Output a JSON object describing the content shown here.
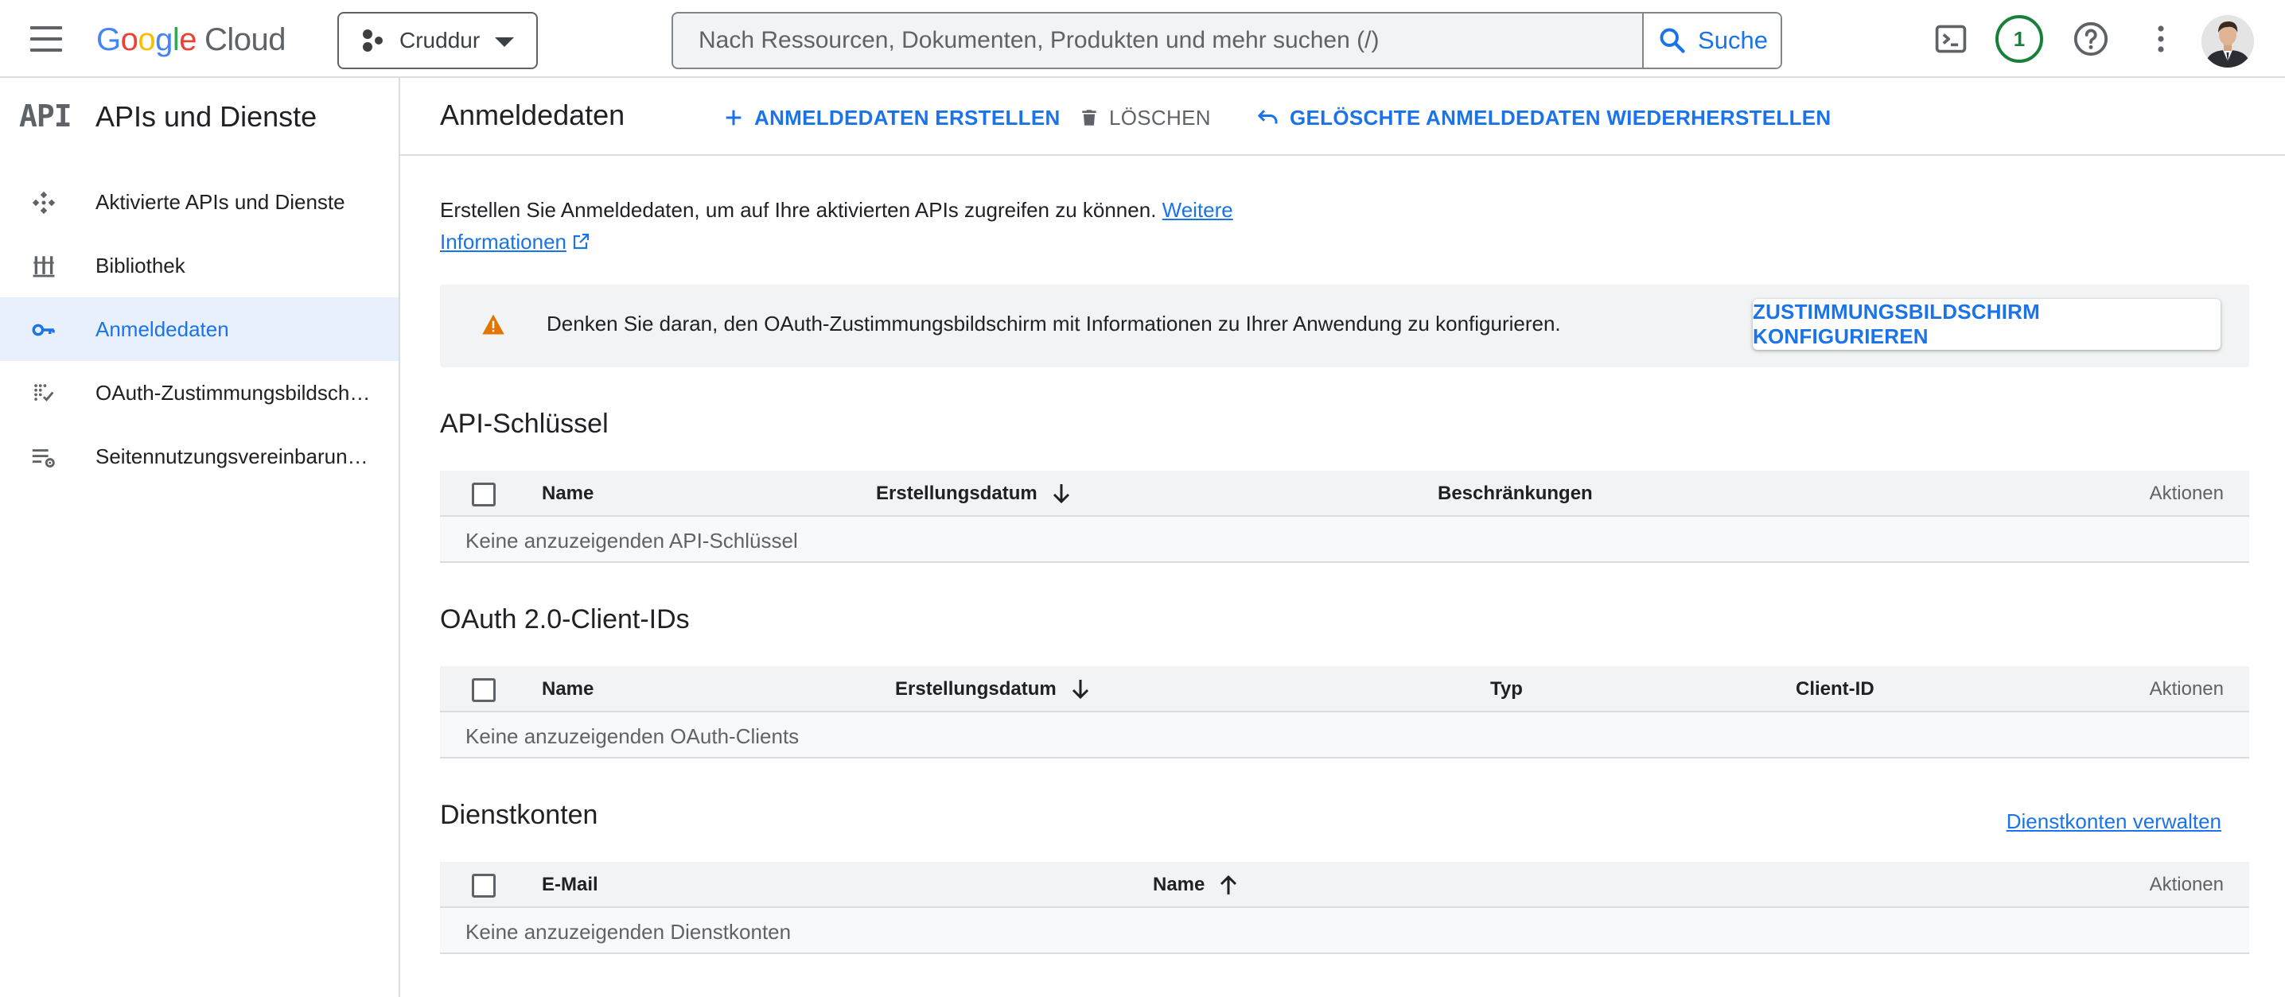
{
  "header": {
    "logo_letters": [
      "G",
      "o",
      "o",
      "g",
      "l",
      "e"
    ],
    "logo_product": "Cloud",
    "project_name": "Cruddur",
    "search_placeholder": "Nach Ressourcen, Dokumenten, Produkten und mehr suchen (/)",
    "search_button": "Suche",
    "notification_count": "1",
    "icons": [
      "menu-icon",
      "project-icon",
      "search-icon",
      "cloud-shell-icon",
      "help-icon",
      "more-vert-icon"
    ]
  },
  "sidebar": {
    "logo": "API",
    "title": "APIs und Dienste",
    "items": [
      {
        "label": "Aktivierte APIs und Dienste",
        "icon": "enabled-apis-icon",
        "active": false
      },
      {
        "label": "Bibliothek",
        "icon": "library-icon",
        "active": false
      },
      {
        "label": "Anmeldedaten",
        "icon": "key-icon",
        "active": true
      },
      {
        "label": "OAuth-Zustimmungsbildschirm",
        "icon": "consent-screen-icon",
        "active": false
      },
      {
        "label": "Seitennutzungsvereinbarungen",
        "icon": "page-usage-icon",
        "active": false
      }
    ]
  },
  "toolbar": {
    "title": "Anmeldedaten",
    "create_label": "ANMELDEDATEN ERSTELLEN",
    "delete_label": "LÖSCHEN",
    "restore_label": "GELÖSCHTE ANMELDEDATEN WIEDERHERSTELLEN"
  },
  "intro": {
    "text": "Erstellen Sie Anmeldedaten, um auf Ihre aktivierten APIs zugreifen zu können.",
    "link_text": "Weitere Informationen"
  },
  "banner": {
    "text": "Denken Sie daran, den OAuth-Zustimmungsbildschirm mit Informationen zu Ihrer Anwendung zu konfigurieren.",
    "button": "ZUSTIMMUNGSBILDSCHIRM KONFIGURIEREN"
  },
  "api_keys": {
    "title": "API-Schlüssel",
    "columns": [
      "Name",
      "Erstellungsdatum",
      "Beschränkungen",
      "Aktionen"
    ],
    "sort": "descending",
    "empty": "Keine anzuzeigenden API-Schlüssel"
  },
  "oauth_clients": {
    "title": "OAuth 2.0-Client-IDs",
    "columns": [
      "Name",
      "Erstellungsdatum",
      "Typ",
      "Client-ID",
      "Aktionen"
    ],
    "sort": "descending",
    "empty": "Keine anzuzeigenden OAuth-Clients"
  },
  "service_accounts": {
    "title": "Dienstkonten",
    "manage_link": "Dienstkonten verwalten",
    "columns": [
      "E-Mail",
      "Name",
      "Aktionen"
    ],
    "sort": "ascending",
    "empty": "Keine anzuzeigenden Dienstkonten"
  },
  "colors": {
    "accent": "#1a73e8",
    "warning": "#e37400",
    "badge": "#188038",
    "active_nav_bg": "#e8f0fe"
  }
}
